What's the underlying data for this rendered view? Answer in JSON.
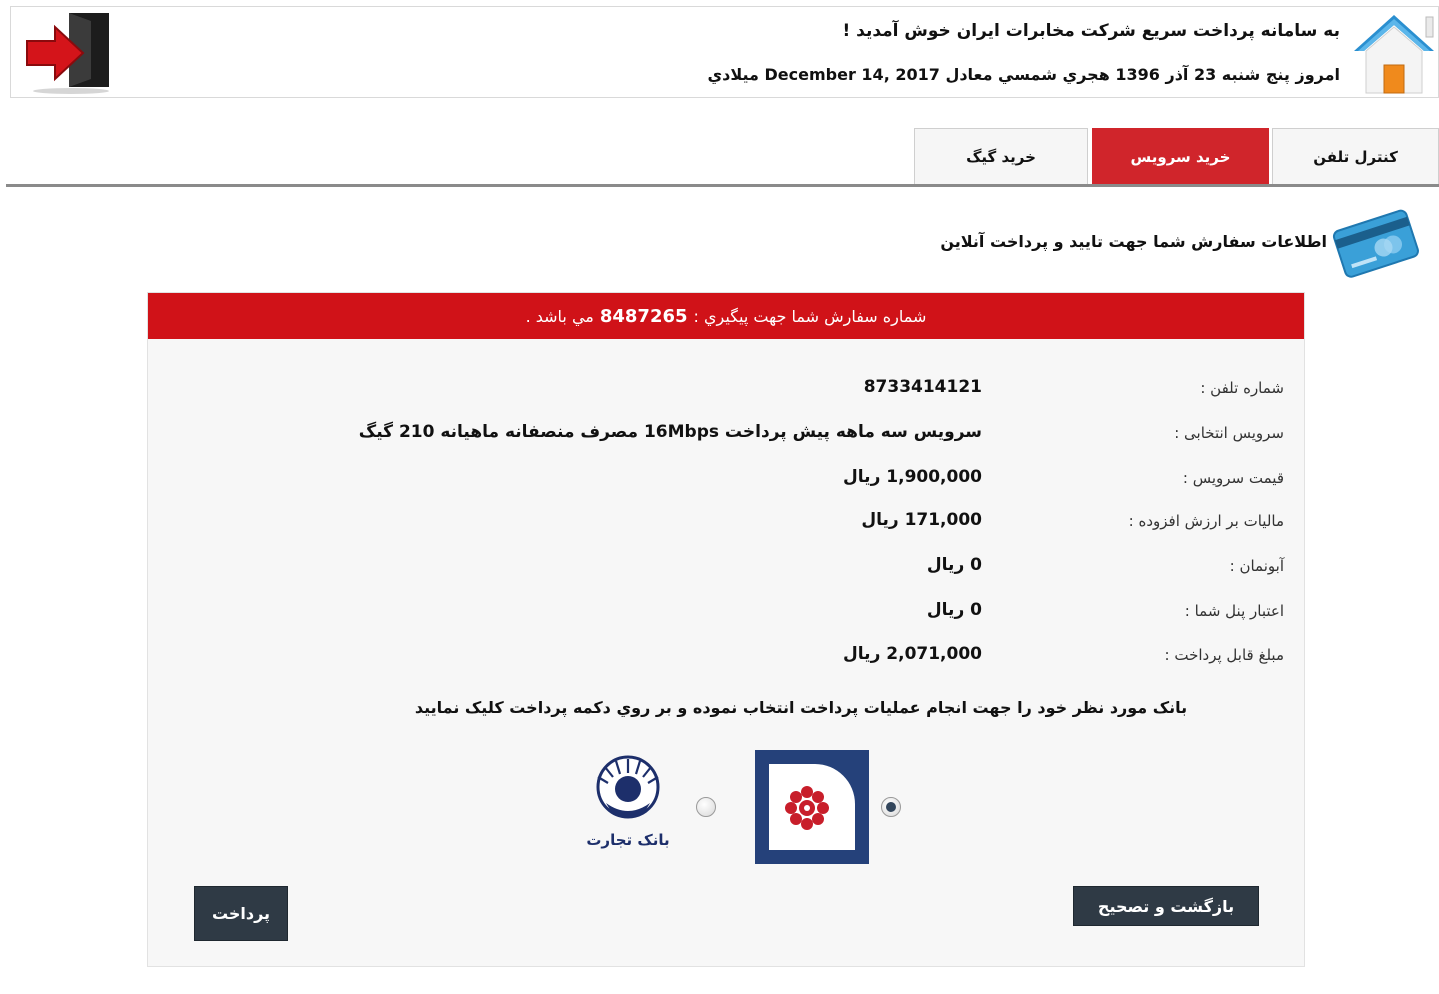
{
  "header": {
    "welcome": "به سامانه پرداخت سريع شرکت مخابرات ايران خوش آمديد !",
    "date": "امروز پنج شنبه 23 آذر 1396 هجري شمسي معادل December 14, 2017 ميلادي"
  },
  "tabs": [
    {
      "label": "کنترل تلفن",
      "active": false
    },
    {
      "label": "خرید سرویس",
      "active": true
    },
    {
      "label": "خرید گیگ",
      "active": false
    }
  ],
  "section_title": "اطلاعات سفارش شما جهت تایید و پرداخت آنلاین",
  "order": {
    "alert_prefix": "شماره سفارش شما جهت پيگيري :",
    "order_number": "8487265",
    "alert_suffix": "مي باشد .",
    "rows": [
      {
        "label": "شماره تلفن :",
        "value": "8733414121"
      },
      {
        "label": "سرویس انتخابی :",
        "value": "سرویس سه ماهه پیش پرداخت 16Mbps مصرف منصفانه ماهیانه 210 گیگ"
      },
      {
        "label": "قیمت سرویس :",
        "value": "1,900,000 ریال"
      },
      {
        "label": "مالیات بر ارزش افزوده :",
        "value": "171,000 ریال"
      },
      {
        "label": "آبونمان :",
        "value": "0 ریال"
      },
      {
        "label": "اعتبار پنل شما :",
        "value": "0 ریال"
      },
      {
        "label": "مبلغ قابل پرداخت :",
        "value": "2,071,000 ریال"
      }
    ],
    "bank_note": "بانک مورد نظر خود را جهت انجام عمليات پرداخت انتخاب نموده و بر روي دکمه پرداخت کليک نماييد",
    "banks": [
      {
        "icon": "saman-bank-logo",
        "selected": true
      },
      {
        "icon": "tejarat-bank-logo",
        "name": "بانک تجارت",
        "selected": false
      }
    ],
    "back_label": "بازگشت و تصحیح",
    "pay_label": "پرداخت"
  },
  "colors": {
    "accent_red": "#d01218",
    "tab_active": "#d0252b",
    "button_dark": "#2f3a45",
    "panel_bg": "#f7f7f7"
  }
}
